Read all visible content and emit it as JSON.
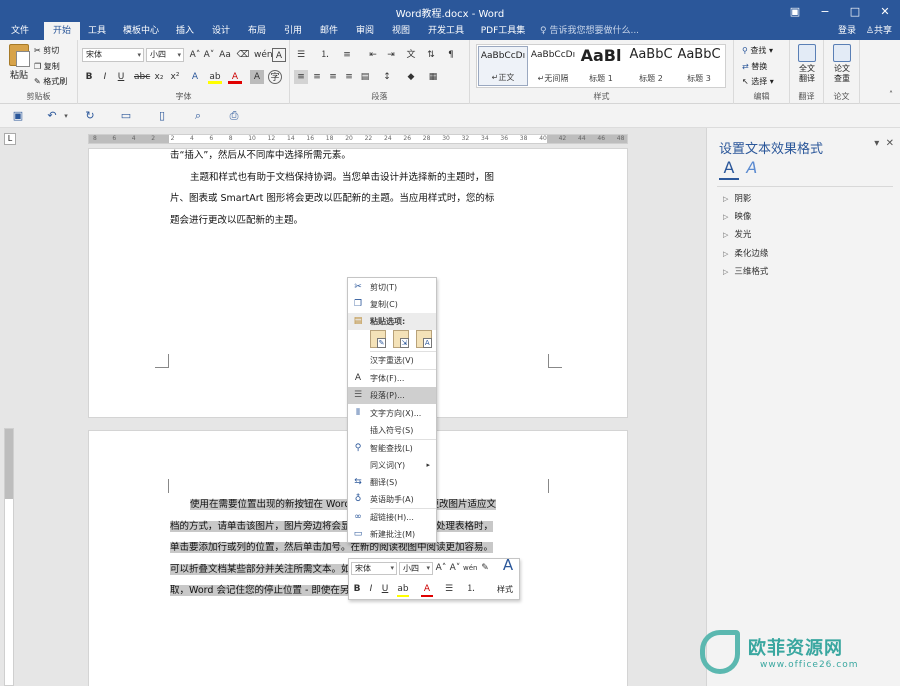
{
  "window": {
    "title": "Word教程.docx - Word",
    "min": "−",
    "max": "□",
    "close": "✕",
    "opts": "▣"
  },
  "tabs": [
    "文件",
    "开始",
    "工具",
    "模板中心",
    "插入",
    "设计",
    "布局",
    "引用",
    "邮件",
    "审阅",
    "视图",
    "开发工具",
    "PDF工具集"
  ],
  "tellme": "告诉我您想要做什么...",
  "signin": "登录",
  "share": "共享",
  "clipboard": {
    "paste": "粘贴",
    "cut": "剪切",
    "copy": "复制",
    "format_painter": "格式刷",
    "label": "剪贴板"
  },
  "font": {
    "name": "宋体",
    "size": "小四",
    "label": "字体"
  },
  "paragraph": {
    "label": "段落"
  },
  "styles": {
    "label": "样式",
    "items": [
      {
        "sample": "AaBbCcDı",
        "name": "↵正文"
      },
      {
        "sample": "AaBbCcDı",
        "name": "↵无间隔"
      },
      {
        "sample": "AaBl",
        "name": "标题 1"
      },
      {
        "sample": "AaBbC",
        "name": "标题 2"
      },
      {
        "sample": "AaBbC",
        "name": "标题 3"
      }
    ]
  },
  "editing": {
    "find": "查找",
    "replace": "替换",
    "select": "选择",
    "label": "编辑"
  },
  "translate": {
    "full": "全文\n翻译",
    "paper": "论文\n查重",
    "group_label_1": "翻译",
    "group_label_2": "论文"
  },
  "document": {
    "page1_lines": [
      "击“插入”，然后从不同库中选择所需元素。",
      "主题和样式也有助于文档保持协调。当您单击设计并选择新的主题时，图",
      "片、图表或 SmartArt 图形将会更改以匹配新的主题。当应用样式时，您的标",
      "题会进行更改以匹配新的主题。"
    ],
    "page2_lines": [
      "使用在需要位置出现的新按钮在 Word 中保存时间。若要更改图片适应文",
      "档的方式，请单击该图片，图片旁边将会显示布局选项按钮。当处理表格时，",
      "单击要添加行或列的位置，然后单击加号。在新的阅读视图中阅读更加容易。",
      "可以折叠文档某些部分并关注所需文本。如果在达到结尾处之前需要停止读",
      "取，Word 会记住您的停止位置 - 即使在另一个设备上。"
    ]
  },
  "context_menu": {
    "cut": "剪切(T)",
    "copy": "复制(C)",
    "paste_options": "粘贴选项:",
    "reconvert": "汉字重选(V)",
    "font": "字体(F)...",
    "paragraph": "段落(P)...",
    "text_direction": "文字方向(X)...",
    "insert_symbol": "插入符号(S)",
    "smart_lookup": "智能查找(L)",
    "synonyms": "同义词(Y)",
    "translate": "翻译(S)",
    "english_assistant": "英语助手(A)",
    "hyperlink": "超链接(H)...",
    "new_comment": "新建批注(M)"
  },
  "mini_toolbar": {
    "font": "宋体",
    "size": "小四",
    "styles": "样式"
  },
  "pane": {
    "title": "设置文本效果格式",
    "items": [
      "阴影",
      "映像",
      "发光",
      "柔化边缘",
      "三维格式"
    ]
  },
  "ruler": {
    "marks": [
      "8",
      "6",
      "4",
      "2",
      "2",
      "4",
      "6",
      "8",
      "10",
      "12",
      "14",
      "16",
      "18",
      "20",
      "22",
      "24",
      "26",
      "28",
      "30",
      "32",
      "34",
      "36",
      "38",
      "40",
      "42",
      "44",
      "46",
      "48"
    ]
  },
  "watermark": {
    "text": "欧菲资源网",
    "url": "www.office26.com"
  }
}
